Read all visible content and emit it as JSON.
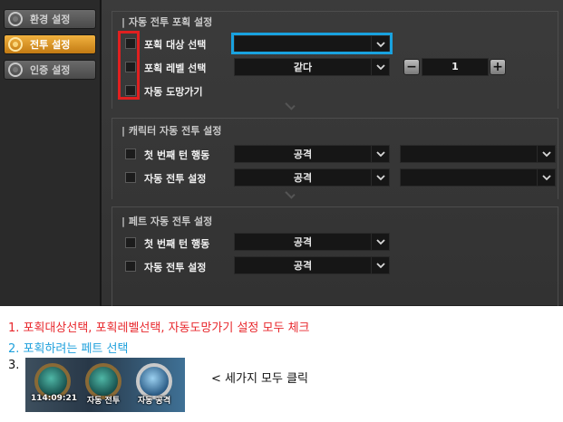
{
  "tabs": [
    {
      "label": "환경 설정",
      "active": false
    },
    {
      "label": "전투 설정",
      "active": true
    },
    {
      "label": "인증 설정",
      "active": false
    }
  ],
  "capture": {
    "title": "| 자동 전투 포획 설정",
    "rows": [
      {
        "label": "포획 대상 선택",
        "dropdown": ""
      },
      {
        "label": "포획 레벨 선택",
        "dropdown": "같다",
        "stepper_value": "1",
        "minus": "−",
        "plus": "+"
      },
      {
        "label": "자동 도망가기"
      }
    ]
  },
  "character": {
    "title": "| 캐릭터 자동 전투 설정",
    "rows": [
      {
        "label": "첫 번째 턴 행동",
        "dropdown": "공격",
        "dropdown2": ""
      },
      {
        "label": "자동 전투 설정",
        "dropdown": "공격",
        "dropdown2": ""
      }
    ]
  },
  "pet": {
    "title": "| 페트 자동 전투 설정",
    "rows": [
      {
        "label": "첫 번째 턴 행동",
        "dropdown": "공격"
      },
      {
        "label": "자동 전투 설정",
        "dropdown": "공격"
      }
    ]
  },
  "highlight_colors": {
    "red": "#e02020",
    "blue": "#19a2df"
  },
  "instructions": {
    "step1": "1. 포획대상선택, 포획레벨선택, 자동도망가기 설정 모두 체크",
    "step2": "2. 포획하려는 페트 선택",
    "step3": "3.",
    "skills": [
      {
        "caption": "114:09:21"
      },
      {
        "caption": "자동 전투"
      },
      {
        "caption": "자동 공격"
      }
    ],
    "click_note": "< 세가지 모두 클릭"
  }
}
